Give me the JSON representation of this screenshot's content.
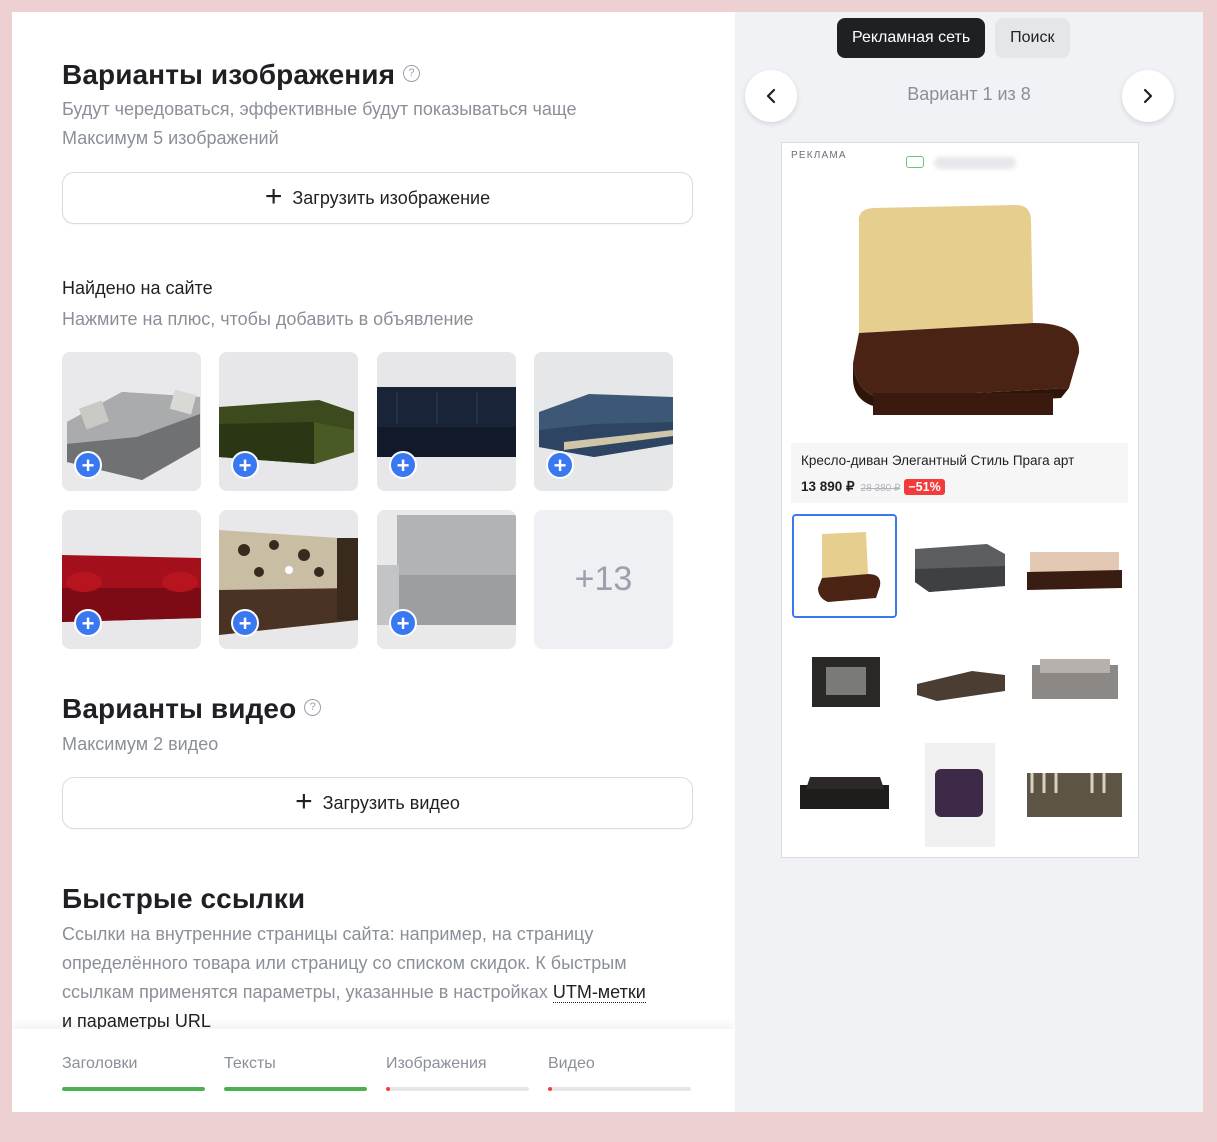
{
  "images_section": {
    "title": "Варианты изображения",
    "help_icon": "?",
    "subtitle_line1": "Будут чередоваться, эффективные будут показываться чаще",
    "subtitle_line2": "Максимум 5 изображений",
    "upload_button": "Загрузить изображение",
    "found_title": "Найдено на сайте",
    "found_hint": "Нажмите на плюс, чтобы добавить в объявление",
    "more_count": "+13"
  },
  "video_section": {
    "title": "Варианты видео",
    "help_icon": "?",
    "subtitle": "Максимум 2 видео",
    "upload_button": "Загрузить видео"
  },
  "quick_links": {
    "title": "Быстрые ссылки",
    "text_before_link": "Ссылки на внутренние страницы сайта: например, на страницу определённого товара или страницу со списком скидок. К быстрым ссылкам применятся параметры, указанные в настройках ",
    "link_text": "UTM-метки",
    "text_after_link": "и параметры URL"
  },
  "progress": [
    {
      "label": "Заголовки",
      "fill": 1.0,
      "color": "#4caf50"
    },
    {
      "label": "Тексты",
      "fill": 1.0,
      "color": "#4caf50"
    },
    {
      "label": "Изображения",
      "fill": 0.03,
      "color": "#f33b3b"
    },
    {
      "label": "Видео",
      "fill": 0.03,
      "color": "#f33b3b"
    }
  ],
  "preview": {
    "tabs": [
      "Рекламная сеть",
      "Поиск"
    ],
    "variant_text": "Вариант 1 из 8",
    "ad_label": "РЕКЛАМА",
    "product_name": "Кресло-диван Элегантный Стиль Прага арт",
    "price": "13 890 ₽",
    "old_price": "28 380 ₽",
    "discount": "−51%"
  },
  "icons": {
    "prev": "chevron-left-icon",
    "next": "chevron-right-icon",
    "add": "plus-icon"
  }
}
